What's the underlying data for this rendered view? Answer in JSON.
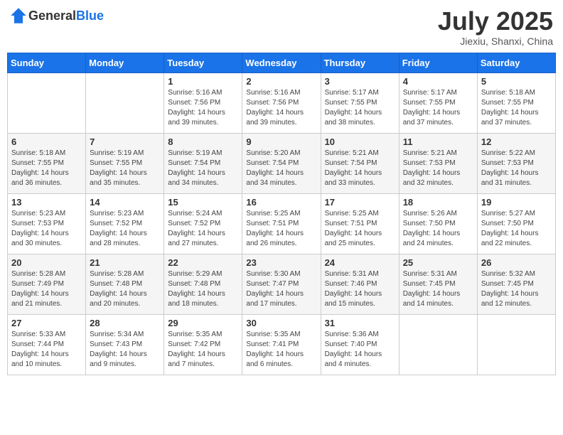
{
  "header": {
    "logo_general": "General",
    "logo_blue": "Blue",
    "month_title": "July 2025",
    "location": "Jiexiu, Shanxi, China"
  },
  "days_of_week": [
    "Sunday",
    "Monday",
    "Tuesday",
    "Wednesday",
    "Thursday",
    "Friday",
    "Saturday"
  ],
  "weeks": [
    [
      {
        "day": "",
        "sunrise": "",
        "sunset": "",
        "daylight": ""
      },
      {
        "day": "",
        "sunrise": "",
        "sunset": "",
        "daylight": ""
      },
      {
        "day": "1",
        "sunrise": "Sunrise: 5:16 AM",
        "sunset": "Sunset: 7:56 PM",
        "daylight": "Daylight: 14 hours and 39 minutes."
      },
      {
        "day": "2",
        "sunrise": "Sunrise: 5:16 AM",
        "sunset": "Sunset: 7:56 PM",
        "daylight": "Daylight: 14 hours and 39 minutes."
      },
      {
        "day": "3",
        "sunrise": "Sunrise: 5:17 AM",
        "sunset": "Sunset: 7:55 PM",
        "daylight": "Daylight: 14 hours and 38 minutes."
      },
      {
        "day": "4",
        "sunrise": "Sunrise: 5:17 AM",
        "sunset": "Sunset: 7:55 PM",
        "daylight": "Daylight: 14 hours and 37 minutes."
      },
      {
        "day": "5",
        "sunrise": "Sunrise: 5:18 AM",
        "sunset": "Sunset: 7:55 PM",
        "daylight": "Daylight: 14 hours and 37 minutes."
      }
    ],
    [
      {
        "day": "6",
        "sunrise": "Sunrise: 5:18 AM",
        "sunset": "Sunset: 7:55 PM",
        "daylight": "Daylight: 14 hours and 36 minutes."
      },
      {
        "day": "7",
        "sunrise": "Sunrise: 5:19 AM",
        "sunset": "Sunset: 7:55 PM",
        "daylight": "Daylight: 14 hours and 35 minutes."
      },
      {
        "day": "8",
        "sunrise": "Sunrise: 5:19 AM",
        "sunset": "Sunset: 7:54 PM",
        "daylight": "Daylight: 14 hours and 34 minutes."
      },
      {
        "day": "9",
        "sunrise": "Sunrise: 5:20 AM",
        "sunset": "Sunset: 7:54 PM",
        "daylight": "Daylight: 14 hours and 34 minutes."
      },
      {
        "day": "10",
        "sunrise": "Sunrise: 5:21 AM",
        "sunset": "Sunset: 7:54 PM",
        "daylight": "Daylight: 14 hours and 33 minutes."
      },
      {
        "day": "11",
        "sunrise": "Sunrise: 5:21 AM",
        "sunset": "Sunset: 7:53 PM",
        "daylight": "Daylight: 14 hours and 32 minutes."
      },
      {
        "day": "12",
        "sunrise": "Sunrise: 5:22 AM",
        "sunset": "Sunset: 7:53 PM",
        "daylight": "Daylight: 14 hours and 31 minutes."
      }
    ],
    [
      {
        "day": "13",
        "sunrise": "Sunrise: 5:23 AM",
        "sunset": "Sunset: 7:53 PM",
        "daylight": "Daylight: 14 hours and 30 minutes."
      },
      {
        "day": "14",
        "sunrise": "Sunrise: 5:23 AM",
        "sunset": "Sunset: 7:52 PM",
        "daylight": "Daylight: 14 hours and 28 minutes."
      },
      {
        "day": "15",
        "sunrise": "Sunrise: 5:24 AM",
        "sunset": "Sunset: 7:52 PM",
        "daylight": "Daylight: 14 hours and 27 minutes."
      },
      {
        "day": "16",
        "sunrise": "Sunrise: 5:25 AM",
        "sunset": "Sunset: 7:51 PM",
        "daylight": "Daylight: 14 hours and 26 minutes."
      },
      {
        "day": "17",
        "sunrise": "Sunrise: 5:25 AM",
        "sunset": "Sunset: 7:51 PM",
        "daylight": "Daylight: 14 hours and 25 minutes."
      },
      {
        "day": "18",
        "sunrise": "Sunrise: 5:26 AM",
        "sunset": "Sunset: 7:50 PM",
        "daylight": "Daylight: 14 hours and 24 minutes."
      },
      {
        "day": "19",
        "sunrise": "Sunrise: 5:27 AM",
        "sunset": "Sunset: 7:50 PM",
        "daylight": "Daylight: 14 hours and 22 minutes."
      }
    ],
    [
      {
        "day": "20",
        "sunrise": "Sunrise: 5:28 AM",
        "sunset": "Sunset: 7:49 PM",
        "daylight": "Daylight: 14 hours and 21 minutes."
      },
      {
        "day": "21",
        "sunrise": "Sunrise: 5:28 AM",
        "sunset": "Sunset: 7:48 PM",
        "daylight": "Daylight: 14 hours and 20 minutes."
      },
      {
        "day": "22",
        "sunrise": "Sunrise: 5:29 AM",
        "sunset": "Sunset: 7:48 PM",
        "daylight": "Daylight: 14 hours and 18 minutes."
      },
      {
        "day": "23",
        "sunrise": "Sunrise: 5:30 AM",
        "sunset": "Sunset: 7:47 PM",
        "daylight": "Daylight: 14 hours and 17 minutes."
      },
      {
        "day": "24",
        "sunrise": "Sunrise: 5:31 AM",
        "sunset": "Sunset: 7:46 PM",
        "daylight": "Daylight: 14 hours and 15 minutes."
      },
      {
        "day": "25",
        "sunrise": "Sunrise: 5:31 AM",
        "sunset": "Sunset: 7:45 PM",
        "daylight": "Daylight: 14 hours and 14 minutes."
      },
      {
        "day": "26",
        "sunrise": "Sunrise: 5:32 AM",
        "sunset": "Sunset: 7:45 PM",
        "daylight": "Daylight: 14 hours and 12 minutes."
      }
    ],
    [
      {
        "day": "27",
        "sunrise": "Sunrise: 5:33 AM",
        "sunset": "Sunset: 7:44 PM",
        "daylight": "Daylight: 14 hours and 10 minutes."
      },
      {
        "day": "28",
        "sunrise": "Sunrise: 5:34 AM",
        "sunset": "Sunset: 7:43 PM",
        "daylight": "Daylight: 14 hours and 9 minutes."
      },
      {
        "day": "29",
        "sunrise": "Sunrise: 5:35 AM",
        "sunset": "Sunset: 7:42 PM",
        "daylight": "Daylight: 14 hours and 7 minutes."
      },
      {
        "day": "30",
        "sunrise": "Sunrise: 5:35 AM",
        "sunset": "Sunset: 7:41 PM",
        "daylight": "Daylight: 14 hours and 6 minutes."
      },
      {
        "day": "31",
        "sunrise": "Sunrise: 5:36 AM",
        "sunset": "Sunset: 7:40 PM",
        "daylight": "Daylight: 14 hours and 4 minutes."
      },
      {
        "day": "",
        "sunrise": "",
        "sunset": "",
        "daylight": ""
      },
      {
        "day": "",
        "sunrise": "",
        "sunset": "",
        "daylight": ""
      }
    ]
  ]
}
